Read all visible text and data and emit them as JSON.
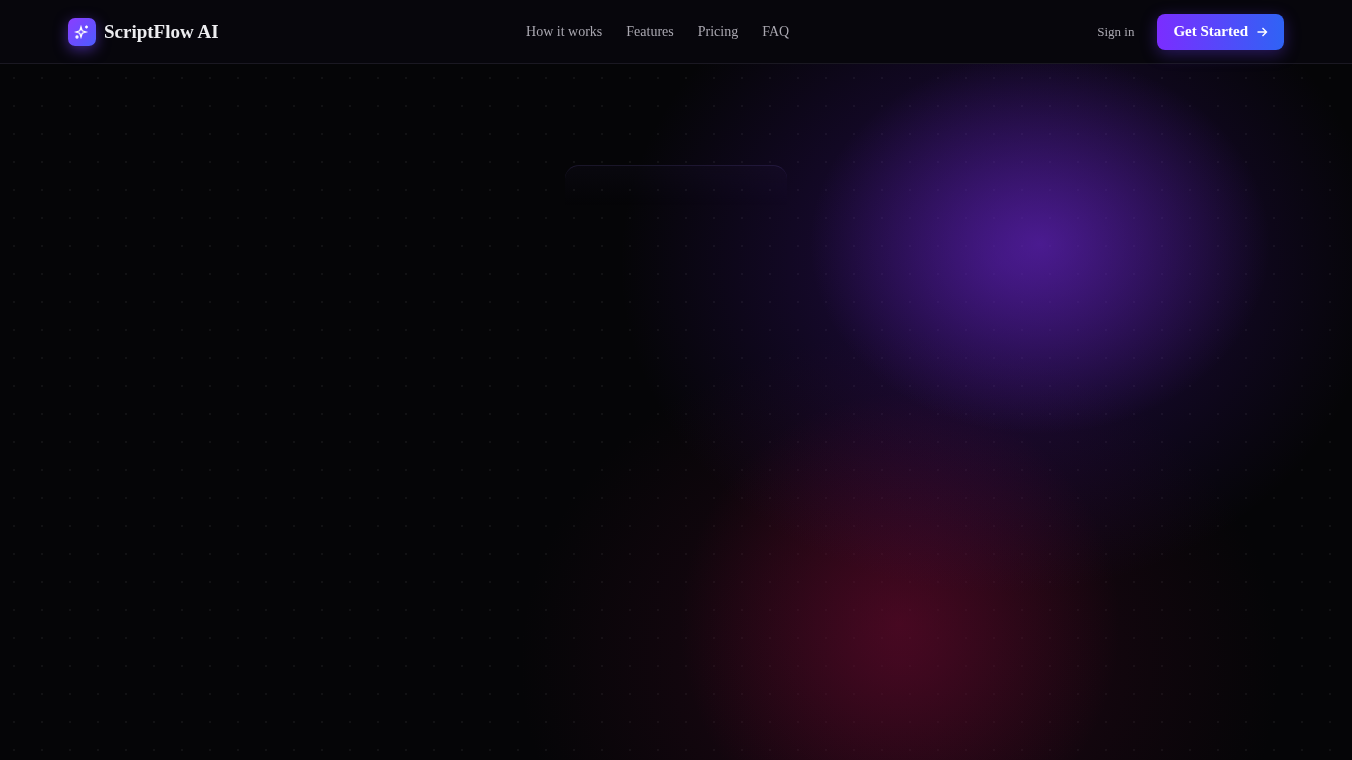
{
  "brand": {
    "name": "ScriptFlow AI"
  },
  "nav": {
    "links": [
      {
        "label": "How it works"
      },
      {
        "label": "Features"
      },
      {
        "label": "Pricing"
      },
      {
        "label": "FAQ"
      }
    ]
  },
  "actions": {
    "sign_in": "Sign in",
    "cta": "Get Started"
  }
}
